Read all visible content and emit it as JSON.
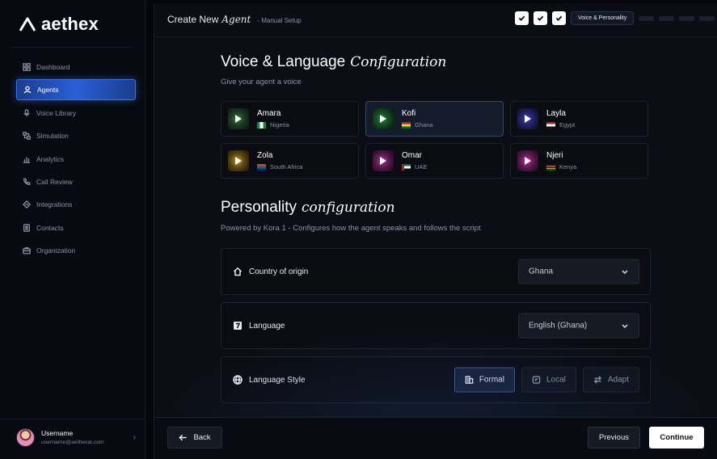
{
  "brand": {
    "name": "aethex"
  },
  "sidebar": {
    "items": [
      {
        "label": "Dashboard",
        "icon": "grid-icon",
        "active": false
      },
      {
        "label": "Agents",
        "icon": "user-icon",
        "active": true
      },
      {
        "label": "Voice Library",
        "icon": "microphone-icon",
        "active": false
      },
      {
        "label": "Simulation",
        "icon": "simulation-icon",
        "active": false
      },
      {
        "label": "Analytics",
        "icon": "bar-chart-icon",
        "active": false
      },
      {
        "label": "Call Review",
        "icon": "phone-icon",
        "active": false
      },
      {
        "label": "Integrations",
        "icon": "integrations-icon",
        "active": false
      },
      {
        "label": "Contacts",
        "icon": "contacts-icon",
        "active": false
      },
      {
        "label": "Organization",
        "icon": "briefcase-icon",
        "active": false
      }
    ],
    "user": {
      "name": "Username",
      "email": "username@aethexai.com"
    }
  },
  "header": {
    "title": "Create New",
    "title_italic": "Agent",
    "subtitle": "- Manual Setup",
    "steps": {
      "current_label": "Voice & Personality",
      "completed": 3,
      "pending": 4
    }
  },
  "voice_section": {
    "title": "Voice & Language",
    "title_italic": "Configuration",
    "subtitle": "Give your agent a voice",
    "voices": [
      {
        "name": "Amara",
        "country": "Nigeria",
        "selected": false,
        "thumb_color": "#2f7a3a"
      },
      {
        "name": "Kofi",
        "country": "Ghana",
        "selected": true,
        "thumb_color": "#1f8a3a"
      },
      {
        "name": "Layla",
        "country": "Egypt",
        "selected": false,
        "thumb_color": "#3b3fb0"
      },
      {
        "name": "Zola",
        "country": "South Africa",
        "selected": false,
        "thumb_color": "#b08a1f"
      },
      {
        "name": "Omar",
        "country": "UAE",
        "selected": false,
        "thumb_color": "#a02a8a"
      },
      {
        "name": "Njeri",
        "country": "Kenya",
        "selected": false,
        "thumb_color": "#b02a8a"
      }
    ]
  },
  "personality_section": {
    "title": "Personality",
    "title_italic": "configuration",
    "subtitle": "Powered by Kora 1 - Configures how the agent speaks and follows the script",
    "country": {
      "label": "Country of origin",
      "value": "Ghana"
    },
    "language": {
      "label": "Language",
      "value": "English (Ghana)"
    },
    "style": {
      "label": "Language Style",
      "options": [
        {
          "label": "Formal",
          "icon": "building-icon",
          "active": true
        },
        {
          "label": "Local",
          "icon": "chat-icon",
          "active": false
        },
        {
          "label": "Adapt",
          "icon": "swap-icon",
          "active": false
        }
      ]
    }
  },
  "footer": {
    "back_label": "Back",
    "previous_label": "Previous",
    "continue_label": "Continue"
  },
  "colors": {
    "accent": "#2a5fd6",
    "background": "#0b0e14",
    "panel": "#0a0c11"
  }
}
